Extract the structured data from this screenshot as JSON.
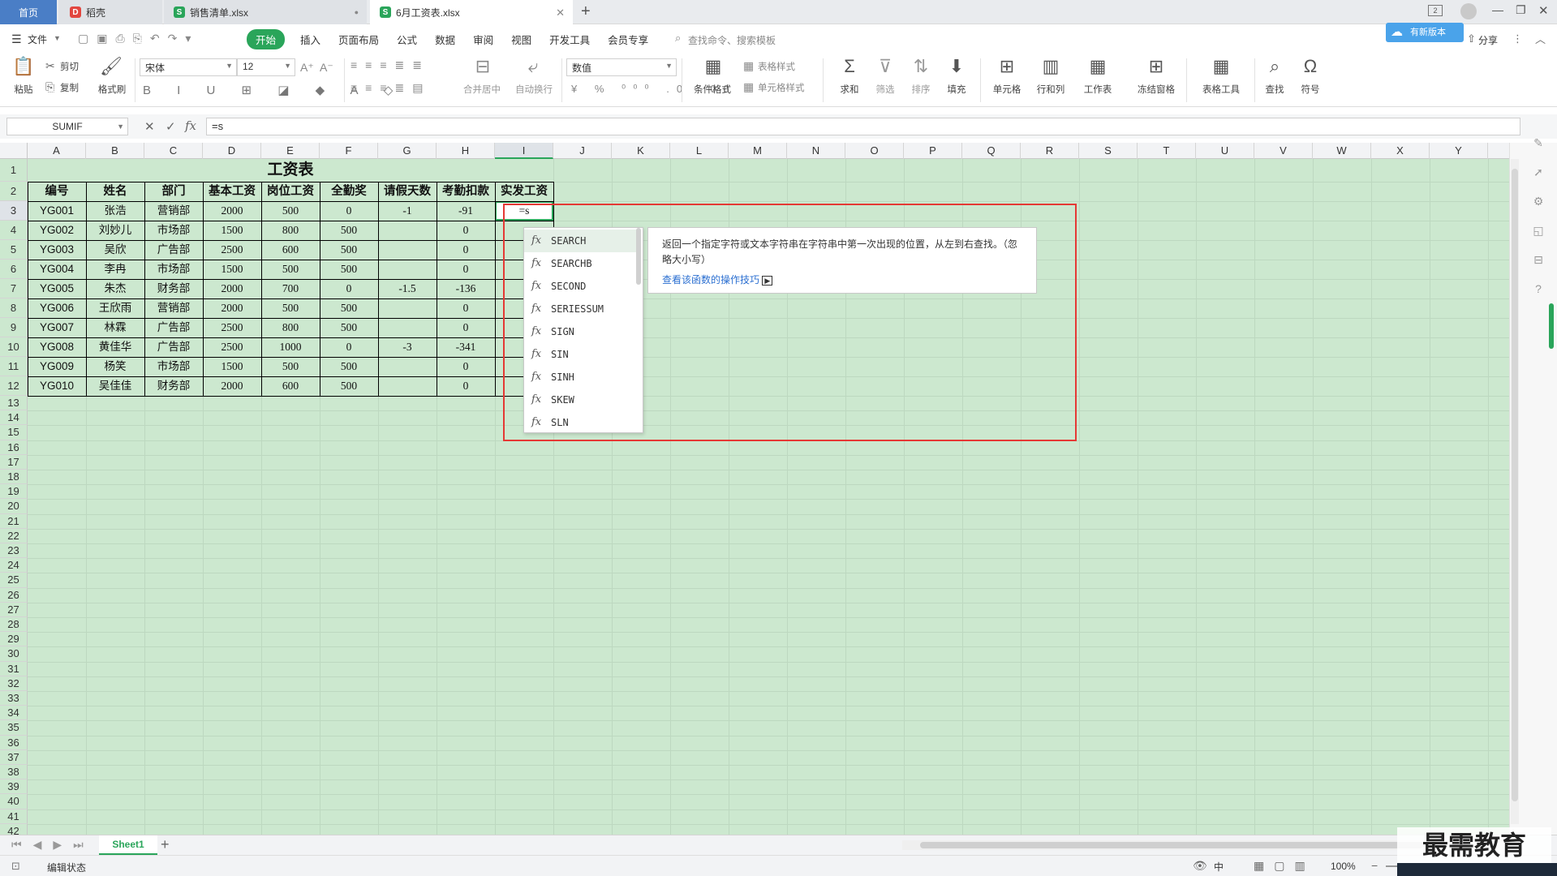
{
  "tabs": {
    "home": "首页",
    "docer": "稻壳",
    "sales": "销售清单.xlsx",
    "salary": "6月工资表.xlsx",
    "new_tab": "+"
  },
  "window": {
    "badge": "2",
    "cloud_label": "有新版本"
  },
  "menu": {
    "file": "文件",
    "items": [
      "开始",
      "插入",
      "页面布局",
      "公式",
      "数据",
      "审阅",
      "视图",
      "开发工具",
      "会员专享"
    ],
    "search_placeholder": "查找命令、搜索模板",
    "share": "分享"
  },
  "ribbon": {
    "paste": "粘贴",
    "cut": "剪切",
    "copy": "复制",
    "format_painter": "格式刷",
    "font_name": "宋体",
    "font_size": "12",
    "merge_center": "合并居中",
    "wrap_text": "自动换行",
    "number_format": "数值",
    "conditional_format": "条件格式",
    "table_style": "表格样式",
    "cell_style": "单元格样式",
    "sum": "求和",
    "filter": "筛选",
    "sort": "排序",
    "fill": "填充",
    "cell": "单元格",
    "row_col": "行和列",
    "worksheet": "工作表",
    "freeze": "冻结窗格",
    "table_tools": "表格工具",
    "find": "查找",
    "symbol": "符号"
  },
  "formula_bar": {
    "name_box": "SUMIF",
    "fx": "fx",
    "content": "=s"
  },
  "columns": [
    "A",
    "B",
    "C",
    "D",
    "E",
    "F",
    "G",
    "H",
    "I",
    "J",
    "K",
    "L",
    "M",
    "N",
    "O",
    "P",
    "Q",
    "R",
    "S",
    "T",
    "U",
    "V",
    "W",
    "X",
    "Y"
  ],
  "sheet": {
    "title": "工资表",
    "headers": [
      "编号",
      "姓名",
      "部门",
      "基本工资",
      "岗位工资",
      "全勤奖",
      "请假天数",
      "考勤扣款",
      "实发工资"
    ],
    "rows": [
      [
        "YG001",
        "张浩",
        "营销部",
        "2000",
        "500",
        "0",
        "-1",
        "-91",
        "=s"
      ],
      [
        "YG002",
        "刘妙儿",
        "市场部",
        "1500",
        "800",
        "500",
        "",
        "0",
        ""
      ],
      [
        "YG003",
        "吴欣",
        "广告部",
        "2500",
        "600",
        "500",
        "",
        "0",
        ""
      ],
      [
        "YG004",
        "李冉",
        "市场部",
        "1500",
        "500",
        "500",
        "",
        "0",
        ""
      ],
      [
        "YG005",
        "朱杰",
        "财务部",
        "2000",
        "700",
        "0",
        "-1.5",
        "-136",
        ""
      ],
      [
        "YG006",
        "王欣雨",
        "营销部",
        "2000",
        "500",
        "500",
        "",
        "0",
        ""
      ],
      [
        "YG007",
        "林霖",
        "广告部",
        "2500",
        "800",
        "500",
        "",
        "0",
        ""
      ],
      [
        "YG008",
        "黄佳华",
        "广告部",
        "2500",
        "1000",
        "0",
        "-3",
        "-341",
        ""
      ],
      [
        "YG009",
        "杨笑",
        "市场部",
        "1500",
        "500",
        "500",
        "",
        "0",
        ""
      ],
      [
        "YG010",
        "吴佳佳",
        "财务部",
        "2000",
        "600",
        "500",
        "",
        "0",
        ""
      ]
    ]
  },
  "autocomplete": {
    "items": [
      "SEARCH",
      "SEARCHB",
      "SECOND",
      "SERIESSUM",
      "SIGN",
      "SIN",
      "SINH",
      "SKEW",
      "SLN"
    ],
    "description": "返回一个指定字符或文本字符串在字符串中第一次出现的位置，从左到右查找。（忽略大小写）",
    "link": "查看该函数的操作技巧"
  },
  "sheet_tab": "Sheet1",
  "status": {
    "mode": "编辑状态",
    "zoom": "100%",
    "ime": "中"
  },
  "watermark": "最需教育",
  "colors": {
    "accent": "#2aa55a",
    "grid_bg": "#cce8cf",
    "highlight": "#e53935"
  }
}
